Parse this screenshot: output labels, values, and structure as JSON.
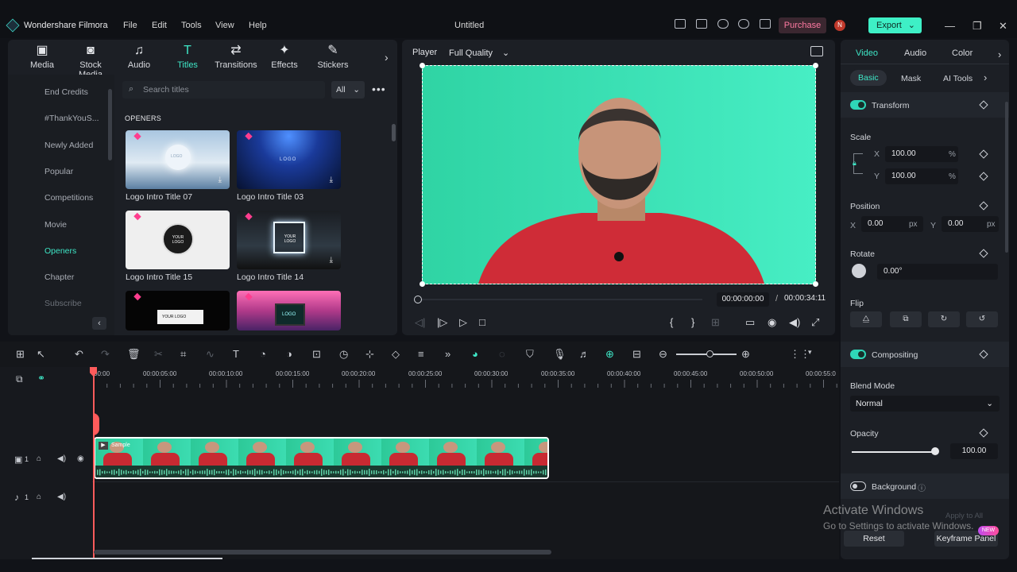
{
  "titlebar": {
    "app_name": "Wondershare Filmora",
    "menu": [
      "File",
      "Edit",
      "Tools",
      "View",
      "Help"
    ],
    "project_title": "Untitled",
    "purchase_label": "Purchase",
    "avatar_initial": "N",
    "export_label": "Export"
  },
  "library": {
    "tabs": [
      {
        "label": "Media",
        "icon": "media-icon"
      },
      {
        "label": "Stock Media",
        "icon": "stock-media-icon"
      },
      {
        "label": "Audio",
        "icon": "music-note-icon"
      },
      {
        "label": "Titles",
        "icon": "titles-icon"
      },
      {
        "label": "Transitions",
        "icon": "transitions-icon"
      },
      {
        "label": "Effects",
        "icon": "effects-icon"
      },
      {
        "label": "Stickers",
        "icon": "stickers-icon"
      }
    ],
    "active_tab": "Titles",
    "sidebar": [
      "End Credits",
      "#ThankYouS...",
      "Newly Added",
      "Popular",
      "Competitions",
      "Movie",
      "Openers",
      "Chapter",
      "Subscribe"
    ],
    "active_sidebar": "Openers",
    "search_placeholder": "Search titles",
    "filter_value": "All",
    "section_header": "OPENERS",
    "items": [
      {
        "name": "Logo Intro Title 07",
        "thumb_text": "LOGO"
      },
      {
        "name": "Logo Intro Title 03",
        "thumb_text": "LOGO"
      },
      {
        "name": "Logo Intro Title 15",
        "thumb_text": "YOUR LOGO"
      },
      {
        "name": "Logo Intro Title 14",
        "thumb_text": "YOUR LOGO"
      },
      {
        "name": "",
        "thumb_text": "YOUR LOGO"
      },
      {
        "name": "",
        "thumb_text": "LOGO"
      }
    ]
  },
  "player": {
    "label": "Player",
    "quality": "Full Quality",
    "current_time": "00:00:00:00",
    "separator": "/",
    "total_time": "00:00:34:11"
  },
  "inspector": {
    "tabs": [
      "Video",
      "Audio",
      "Color"
    ],
    "active_tab": "Video",
    "subtabs": [
      "Basic",
      "Mask",
      "AI Tools"
    ],
    "active_subtab": "Basic",
    "transform_label": "Transform",
    "scale_label": "Scale",
    "scale_x_label": "X",
    "scale_x": "100.00",
    "scale_y_label": "Y",
    "scale_y": "100.00",
    "percent_unit": "%",
    "position_label": "Position",
    "pos_x_label": "X",
    "pos_x": "0.00",
    "pos_y_label": "Y",
    "pos_y": "0.00",
    "px_unit": "px",
    "rotate_label": "Rotate",
    "rotate_value": "0.00°",
    "flip_label": "Flip",
    "compositing_label": "Compositing",
    "blend_mode_label": "Blend Mode",
    "blend_mode_value": "Normal",
    "opacity_label": "Opacity",
    "opacity_value": "100.00",
    "opacity_fraction": 1.0,
    "background_label": "Background",
    "apply_all_label": "Apply to All",
    "reset_label": "Reset",
    "keyframe_panel_label": "Keyframe Panel",
    "new_badge": "NEW"
  },
  "timeline": {
    "ruler_ticks": [
      "00:00",
      "00:00:05:00",
      "00:00:10:00",
      "00:00:15:00",
      "00:00:20:00",
      "00:00:25:00",
      "00:00:30:00",
      "00:00:35:00",
      "00:00:40:00",
      "00:00:45:00",
      "00:00:50:00",
      "00:00:55:0"
    ],
    "video_track_num": "1",
    "audio_track_num": "1",
    "clip_name": "Sample"
  },
  "watermark": {
    "line1": "Activate Windows",
    "line2": "Go to Settings to activate Windows."
  },
  "colors": {
    "accent": "#3ee6c6",
    "purchase": "#ff7aa2",
    "playhead": "#ff5b5b",
    "greenscreen": "#3be0b4"
  }
}
